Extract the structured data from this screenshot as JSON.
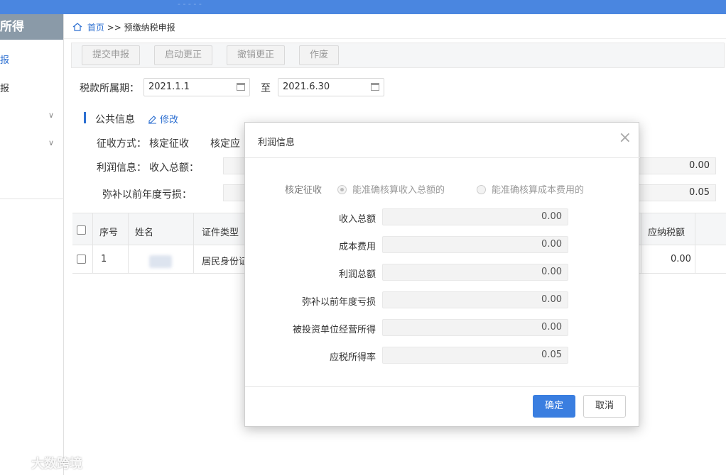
{
  "topbar": {
    "ghost_text": "- - - - -"
  },
  "sidebar": {
    "title": "所得",
    "items": [
      {
        "label": "报",
        "active": true
      },
      {
        "label": "报",
        "active": false
      }
    ]
  },
  "breadcrumb": {
    "home": "首页",
    "separator": ">>",
    "current": "预缴纳税申报"
  },
  "toolbar": {
    "buttons": [
      "提交申报",
      "启动更正",
      "撤销更正",
      "作废"
    ]
  },
  "period": {
    "label": "税款所属期：",
    "start": "2021.1.1",
    "to": "至",
    "end": "2021.6.30"
  },
  "public_info": {
    "title": "公共信息",
    "edit": "修改",
    "collect_label": "征收方式：",
    "collect_value": "核定征收",
    "collect_extra": "核定应",
    "profit_label": "利润信息：",
    "income_label": "收入总额：",
    "income_value": "0.00",
    "loss_label": "弥补以前年度亏损：",
    "loss_value": "0.05"
  },
  "table": {
    "headers": {
      "index": "序号",
      "name": "姓名",
      "id_type": "证件类型",
      "tax_due": "应纳税额"
    },
    "rows": [
      {
        "index": "1",
        "id_type": "居民身份证",
        "tax_due": "0.00"
      }
    ]
  },
  "modal": {
    "title": "利润信息",
    "radio_group_label": "核定征收",
    "radio_1": "能准确核算收入总额的",
    "radio_2": "能准确核算成本费用的",
    "fields": [
      {
        "label": "收入总额",
        "value": "0.00"
      },
      {
        "label": "成本费用",
        "value": "0.00"
      },
      {
        "label": "利润总额",
        "value": "0.00"
      },
      {
        "label": "弥补以前年度亏损",
        "value": "0.00"
      },
      {
        "label": "被投资单位经营所得",
        "value": "0.00"
      },
      {
        "label": "应税所得率",
        "value": "0.05"
      }
    ],
    "ok": "确定",
    "cancel": "取消"
  },
  "watermark": "大数跨境",
  "colors": {
    "accent": "#3a7ee0",
    "orange": "#e8962a",
    "topbar": "#4a86e0"
  }
}
